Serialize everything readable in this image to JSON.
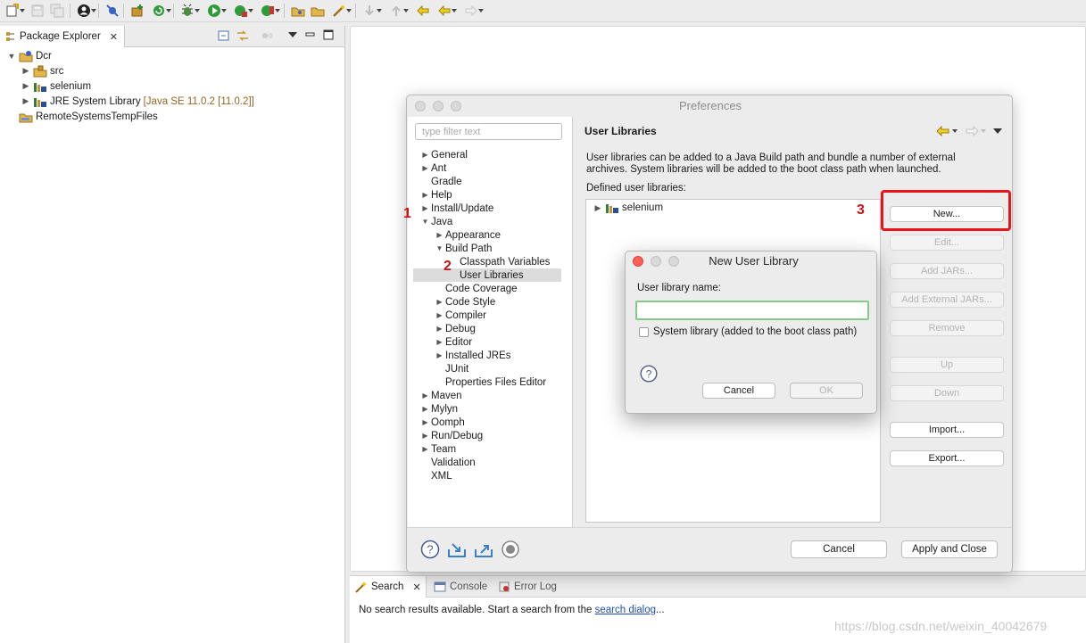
{
  "package_explorer": {
    "tab_label": "Package Explorer",
    "tree": [
      {
        "label": "Dcr",
        "suffix": ""
      },
      {
        "label": "src",
        "suffix": ""
      },
      {
        "label": "selenium",
        "suffix": ""
      },
      {
        "label": "JRE System Library",
        "suffix": " [Java SE 11.0.2 [11.0.2]]"
      },
      {
        "label": "RemoteSystemsTempFiles",
        "suffix": ""
      }
    ]
  },
  "preferences": {
    "title": "Preferences",
    "filter_placeholder": "type filter text",
    "tree": [
      "General",
      "Ant",
      "Gradle",
      "Help",
      "Install/Update",
      "Java",
      "Appearance",
      "Build Path",
      "Classpath Variables",
      "User Libraries",
      "Code Coverage",
      "Code Style",
      "Compiler",
      "Debug",
      "Editor",
      "Installed JREs",
      "JUnit",
      "Properties Files Editor",
      "Maven",
      "Mylyn",
      "Oomph",
      "Run/Debug",
      "Team",
      "Validation",
      "XML"
    ],
    "page_title": "User Libraries",
    "description": "User libraries can be added to a Java Build path and bundle a number of external archives. System libraries will be added to the boot class path when launched.",
    "defined_label": "Defined user libraries:",
    "libraries": [
      "selenium"
    ],
    "buttons": {
      "new": "New...",
      "edit": "Edit...",
      "add_jars": "Add JARs...",
      "add_external_jars": "Add External JARs...",
      "remove": "Remove",
      "up": "Up",
      "down": "Down",
      "import": "Import...",
      "export": "Export..."
    },
    "cancel": "Cancel",
    "apply_close": "Apply and Close"
  },
  "annotations": [
    "1",
    "2",
    "3"
  ],
  "new_user_library": {
    "title": "New User Library",
    "name_label": "User library name:",
    "name_value": "",
    "system_checkbox": "System library (added to the boot class path)",
    "cancel": "Cancel",
    "ok": "OK"
  },
  "bottom_panel": {
    "tabs": [
      "Search",
      "Console",
      "Error Log"
    ],
    "message_prefix": "No search results available. Start a search from the ",
    "message_link": "search dialog",
    "message_suffix": "..."
  },
  "watermark": "https://blog.csdn.net/weixin_40042679",
  "colors": {
    "annotation_red": "#d01010",
    "highlight_box": "#e8141c",
    "link_blue": "#1f4db3",
    "input_focus_green": "#86c88a"
  }
}
